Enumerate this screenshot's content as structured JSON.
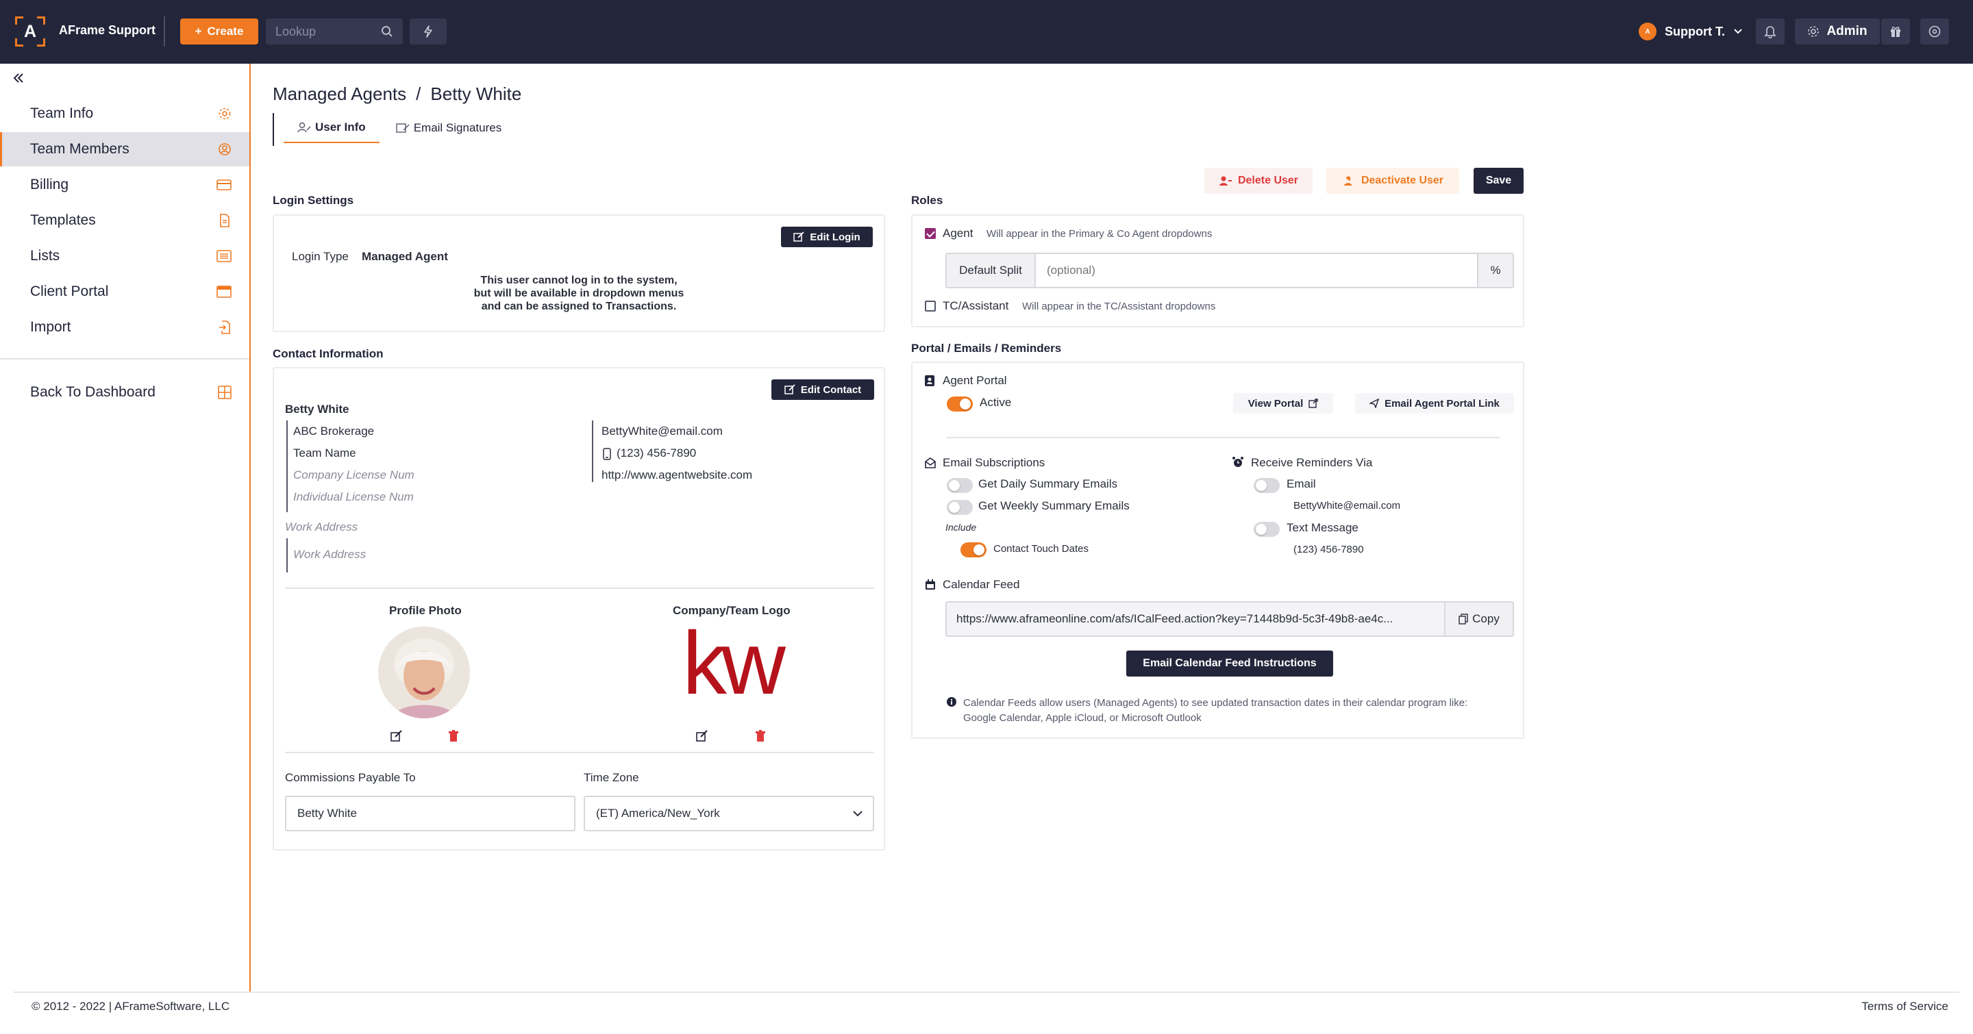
{
  "app": {
    "title": "AFrame Support",
    "logo_letter": "A"
  },
  "topbar": {
    "create_label": "Create",
    "lookup_placeholder": "Lookup",
    "user_name": "Support T.",
    "user_initial": "A",
    "admin_label": "Admin"
  },
  "sidebar": {
    "items": [
      {
        "label": "Team Info",
        "icon": "gear-icon"
      },
      {
        "label": "Team Members",
        "icon": "user-circle-icon"
      },
      {
        "label": "Billing",
        "icon": "credit-card-icon"
      },
      {
        "label": "Templates",
        "icon": "document-icon"
      },
      {
        "label": "Lists",
        "icon": "list-icon"
      },
      {
        "label": "Client Portal",
        "icon": "window-icon"
      },
      {
        "label": "Import",
        "icon": "import-icon"
      }
    ],
    "back_label": "Back To Dashboard",
    "active_item": "Team Members"
  },
  "breadcrumb": {
    "parent": "Managed Agents",
    "separator": "/",
    "current": "Betty White"
  },
  "tabs": [
    {
      "label": "User Info",
      "active": true
    },
    {
      "label": "Email Signatures",
      "active": false
    }
  ],
  "actions": {
    "delete_label": "Delete User",
    "deactivate_label": "Deactivate User",
    "save_label": "Save"
  },
  "login_settings": {
    "title": "Login Settings",
    "edit_label": "Edit Login",
    "login_type_label": "Login Type",
    "login_type_value": "Managed Agent",
    "notice_line1": "This user cannot log in to the system,",
    "notice_line2": "but will be available in dropdown menus",
    "notice_line3": "and can be assigned to Transactions."
  },
  "contact": {
    "title": "Contact Information",
    "edit_label": "Edit Contact",
    "name": "Betty White",
    "brokerage": "ABC Brokerage",
    "team_name": "Team Name",
    "company_license_placeholder": "Company License Num",
    "individual_license_placeholder": "Individual License Num",
    "email": "BettyWhite@email.com",
    "phone": "(123) 456-7890",
    "website": "http://www.agentwebsite.com",
    "work_address_label": "Work Address",
    "work_address_placeholder": "Work Address",
    "profile_photo_label": "Profile Photo",
    "logo_label": "Company/Team Logo",
    "logo_text": "kw",
    "commissions_label": "Commissions Payable To",
    "commissions_value": "Betty White",
    "timezone_label": "Time Zone",
    "timezone_value": "(ET) America/New_York"
  },
  "roles": {
    "title": "Roles",
    "agent_label": "Agent",
    "agent_checked": true,
    "agent_hint": "Will appear in the Primary & Co Agent dropdowns",
    "default_split_label": "Default Split",
    "default_split_placeholder": "(optional)",
    "percent_label": "%",
    "tc_label": "TC/Assistant",
    "tc_checked": false,
    "tc_hint": "Will appear in the TC/Assistant dropdowns"
  },
  "portal": {
    "title": "Portal / Emails / Reminders",
    "agent_portal_label": "Agent Portal",
    "active_label": "Active",
    "active_on": true,
    "view_portal_label": "View Portal",
    "email_link_label": "Email Agent Portal Link",
    "subscriptions_label": "Email Subscriptions",
    "daily_label": "Get Daily Summary Emails",
    "daily_on": false,
    "weekly_label": "Get Weekly Summary Emails",
    "weekly_on": false,
    "include_label": "Include",
    "touch_dates_label": "Contact Touch Dates",
    "touch_dates_on": true,
    "reminders_label": "Receive Reminders Via",
    "reminder_email_label": "Email",
    "reminder_email_on": false,
    "reminder_email_value": "BettyWhite@email.com",
    "reminder_text_label": "Text Message",
    "reminder_text_on": false,
    "reminder_text_value": "(123) 456-7890",
    "calendar_label": "Calendar Feed",
    "calendar_url": "https://www.aframeonline.com/afs/ICalFeed.action?key=71448b9d-5c3f-49b8-ae4c...",
    "copy_label": "Copy",
    "calendar_button": "Email Calendar Feed Instructions",
    "info_line1": "Calendar Feeds allow users (Managed Agents) to see updated transaction dates in their calendar program like:",
    "info_line2": "Google Calendar, Apple iCloud, or Microsoft Outlook"
  },
  "footer": {
    "copyright": "© 2012 - 2022 | AFrameSoftware, LLC",
    "terms": "Terms of Service"
  },
  "colors": {
    "accent": "#f07a22",
    "navy": "#23253a",
    "danger": "#e03a3a",
    "checkbox": "#8e2a72",
    "kw_red": "#b5121b"
  }
}
